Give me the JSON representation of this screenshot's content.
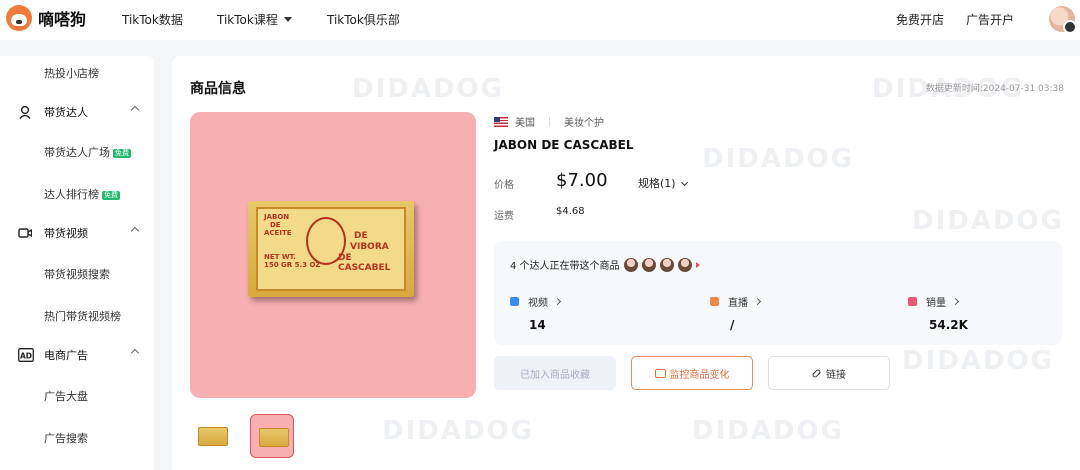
{
  "app": {
    "name": "嘀嗒狗"
  },
  "topnav": {
    "items": [
      "TikTok数据",
      "TikTok课程",
      "TikTok俱乐部"
    ],
    "right": [
      "免费开店",
      "广告开户"
    ]
  },
  "sidebar": {
    "items": [
      {
        "label": "热投小店榜",
        "type": "sub"
      },
      {
        "label": "带货达人",
        "type": "section",
        "icon": "person-icon"
      },
      {
        "label": "带货达人广场",
        "type": "sub",
        "badge": "免费"
      },
      {
        "label": "达人排行榜",
        "type": "sub",
        "badge": "免费"
      },
      {
        "label": "带货视频",
        "type": "section",
        "icon": "video-camera-icon"
      },
      {
        "label": "带货视频搜索",
        "type": "sub"
      },
      {
        "label": "热门带货视频榜",
        "type": "sub"
      },
      {
        "label": "电商广告",
        "type": "section",
        "icon": "ad-icon"
      },
      {
        "label": "广告大盘",
        "type": "sub"
      },
      {
        "label": "广告搜索",
        "type": "sub"
      }
    ],
    "ad_icon_text": "AD"
  },
  "product": {
    "section_title": "商品信息",
    "updated": "数据更新时间:2024-07-31 03:38",
    "region": "美国",
    "category": "美妆个护",
    "name": "JABON DE CASCABEL",
    "price_label": "价格",
    "price": "$7.00",
    "spec": "规格(1)",
    "shipping_label": "运费",
    "shipping": "$4.68",
    "creators_text": "4 个达人正在带这个商品",
    "stats": [
      {
        "label": "视频",
        "value": "14",
        "color": "#3d8bf5"
      },
      {
        "label": "直播",
        "value": "/",
        "color": "#f08a4b"
      },
      {
        "label": "销量",
        "value": "54.2K",
        "color": "#ee5577"
      }
    ],
    "buttons": {
      "favorite": "已加入商品收藏",
      "monitor": "监控商品变化",
      "link": "链接"
    },
    "image_text": {
      "line1": "JABON",
      "line2": "DE",
      "line3": "ACEITE",
      "big1": "DE",
      "big2": "VIBORA",
      "big3": "DE CASCABEL",
      "net": "NET WT.",
      "net2": "150 GR 5.3 OZ"
    }
  },
  "watermark": "DIDADOG",
  "colors": {
    "accent": "#e86a3a",
    "badge": "#25b96f",
    "hero_bg": "#f7afb2"
  }
}
